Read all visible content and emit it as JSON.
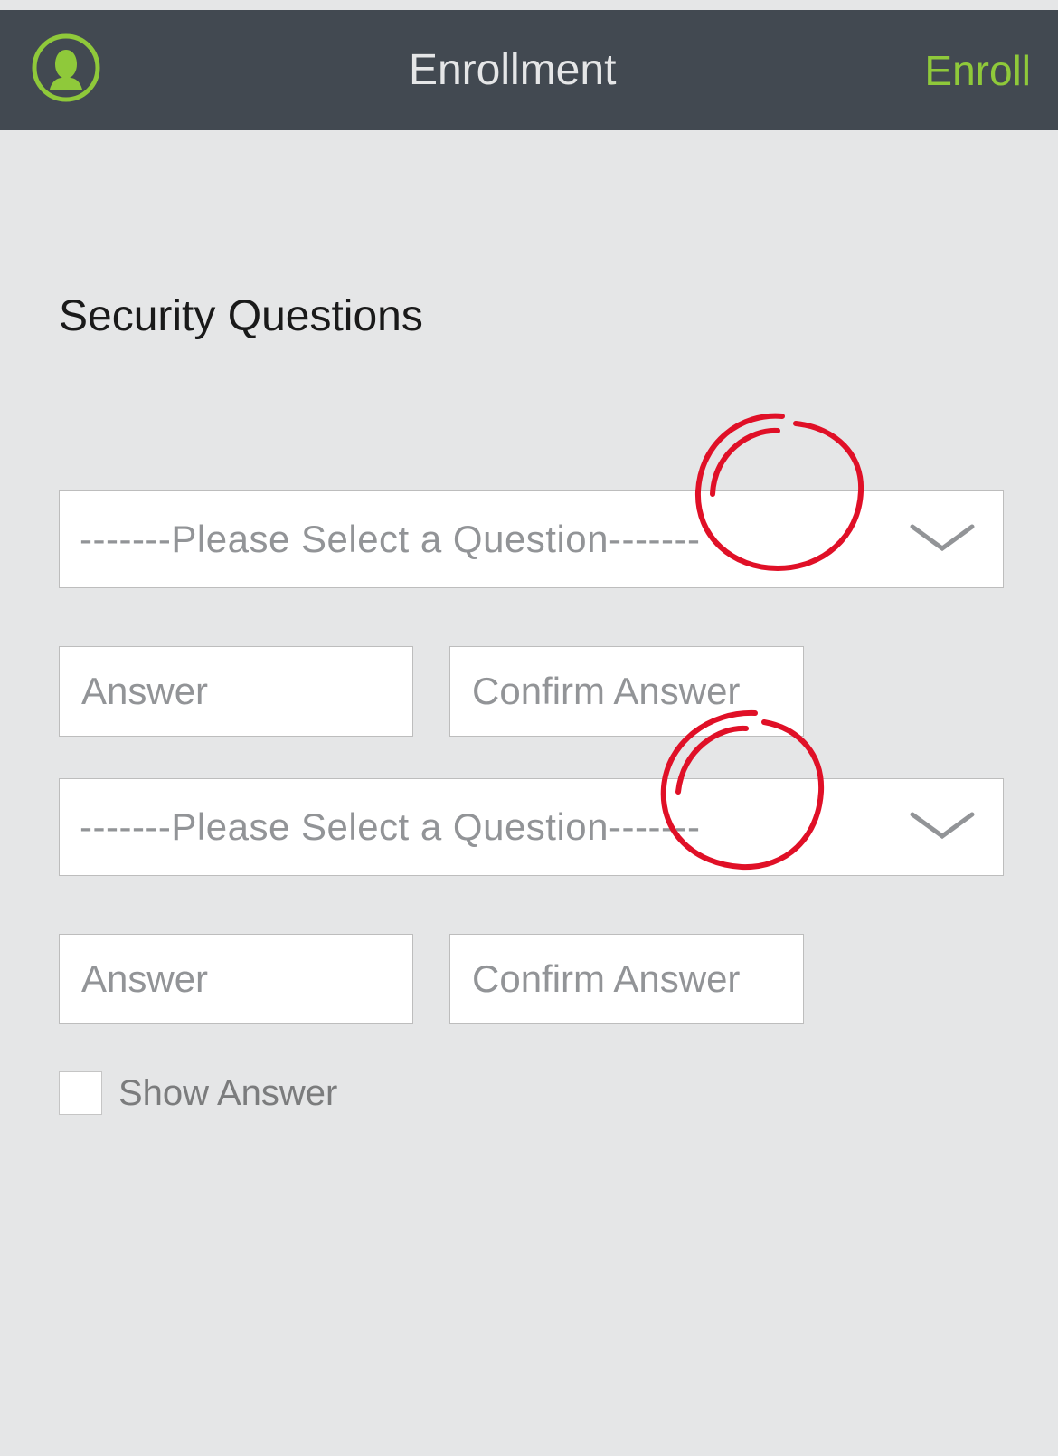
{
  "header": {
    "title": "Enrollment",
    "action": "Enroll"
  },
  "section": {
    "title": "Security Questions"
  },
  "question1": {
    "placeholder": "-------Please Select a Question-------",
    "answerPlaceholder": "Answer",
    "confirmPlaceholder": "Confirm Answer"
  },
  "question2": {
    "placeholder": "-------Please Select a Question-------",
    "answerPlaceholder": "Answer",
    "confirmPlaceholder": "Confirm Answer"
  },
  "showAnswer": {
    "label": "Show Answer"
  },
  "colors": {
    "headerBg": "#424951",
    "accent": "#8fc93a",
    "textMuted": "#929497",
    "border": "#bdbdbd",
    "annotation": "#e01027"
  }
}
